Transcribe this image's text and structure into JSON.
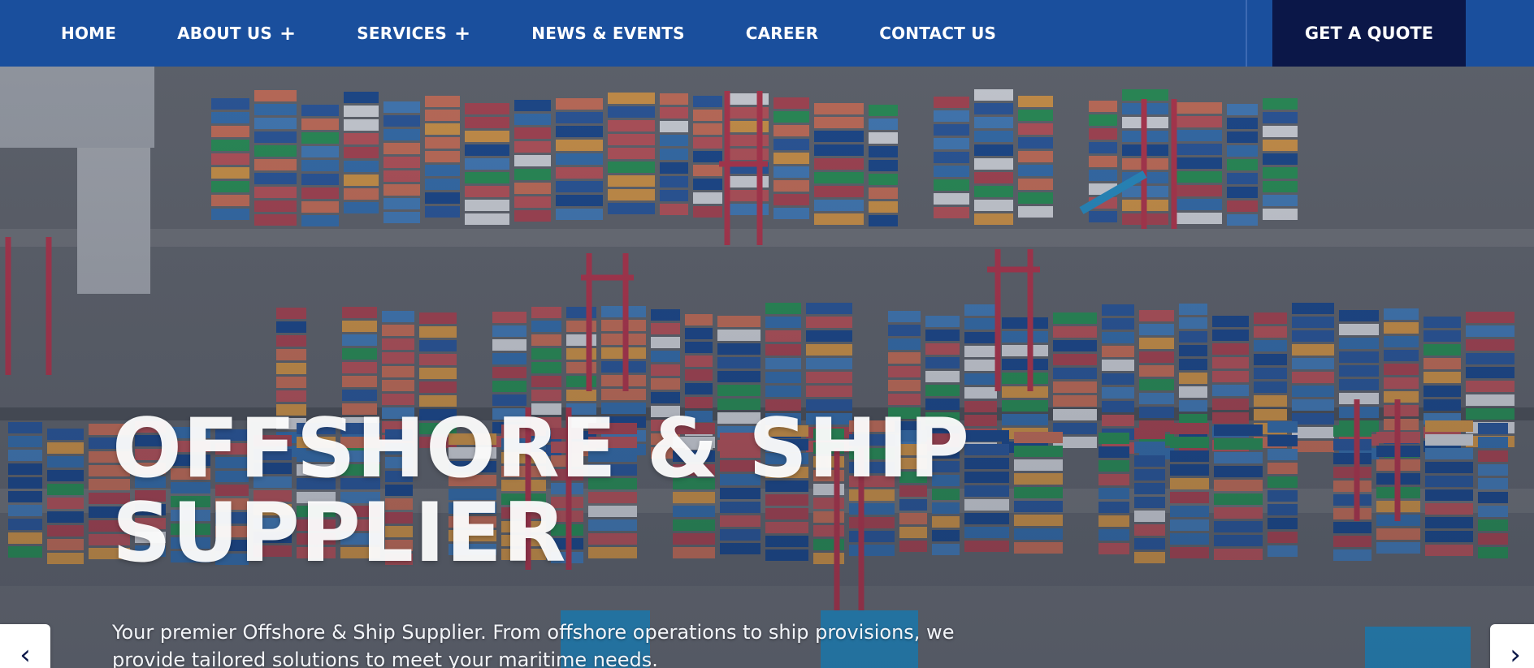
{
  "nav": {
    "items": [
      {
        "label": "HOME",
        "has_submenu": false
      },
      {
        "label": "ABOUT US",
        "has_submenu": true
      },
      {
        "label": "SERVICES",
        "has_submenu": true
      },
      {
        "label": "NEWS & EVENTS",
        "has_submenu": false
      },
      {
        "label": "CAREER",
        "has_submenu": false
      },
      {
        "label": "CONTACT US",
        "has_submenu": false
      }
    ],
    "submenu_glyph": "+",
    "cta_label": "GET A QUOTE"
  },
  "hero": {
    "title_line1": "OFFSHORE & SHIP",
    "title_line2": "SUPPLIER",
    "subtitle_line1": "Your premier Offshore & Ship Supplier. From offshore operations to ship provisions, we",
    "subtitle_line2": "provide tailored solutions to meet your maritime needs.",
    "background": "aerial-container-port-image"
  },
  "slider": {
    "prev_glyph": "‹",
    "next_glyph": "›"
  },
  "colors": {
    "nav_bg": "#1a4f9d",
    "cta_bg": "#0b1748",
    "text": "#ffffff"
  }
}
